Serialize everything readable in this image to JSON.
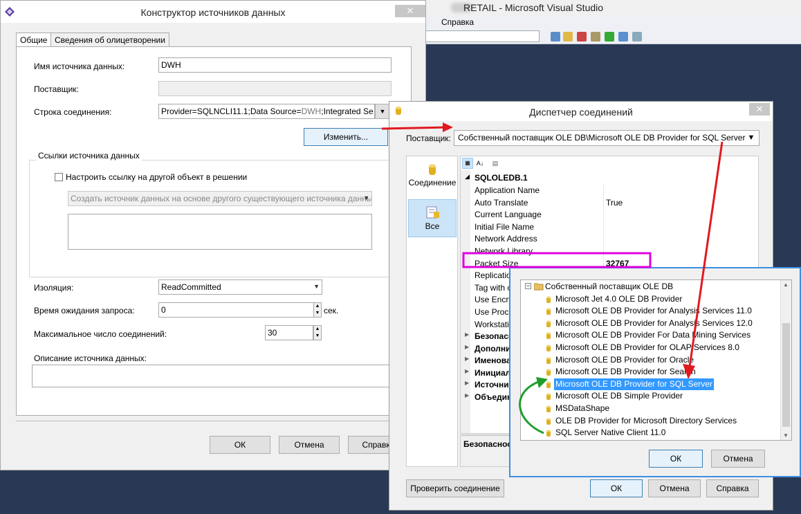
{
  "vs": {
    "title": "RETAIL - Microsoft Visual Studio",
    "menu_help": "Справка"
  },
  "dlg1": {
    "title": "Конструктор источников данных",
    "tabs": [
      "Общие",
      "Сведения об олицетворении"
    ],
    "ds_name_label": "Имя источника данных:",
    "ds_name_value": "DWH",
    "provider_label": "Поставщик:",
    "conn_label": "Строка соединения:",
    "conn_value": "Provider=SQLNCLI11.1;Data Source=",
    "conn_value_tail": "DWH",
    "conn_value_end": ";Integrated Se",
    "edit_button": "Изменить...",
    "refs_group": "Ссылки источника данных",
    "refs_checkbox": "Настроить ссылку на другой объект в решении",
    "refs_combo": "Создать источник данных на основе другого существующего источника данных",
    "isolation_label": "Изоляция:",
    "isolation_value": "ReadCommitted",
    "timeout_label": "Время ожидания запроса:",
    "timeout_value": "0",
    "timeout_unit": "сек.",
    "maxconn_label": "Максимальное число соединений:",
    "maxconn_value": "30",
    "desc_label": "Описание источника данных:",
    "ok": "ОК",
    "cancel": "Отмена",
    "help": "Справка"
  },
  "dlg2": {
    "title": "Диспетчер соединений",
    "provider_label": "Поставщик:",
    "provider_value": "Собственный поставщик OLE DB\\Microsoft OLE DB Provider for SQL Server",
    "side_items": [
      "Соединение",
      "Все"
    ],
    "grid_header": "SQLOLEDB.1",
    "rows": [
      {
        "k": "Application Name",
        "v": ""
      },
      {
        "k": "Auto Translate",
        "v": "True"
      },
      {
        "k": "Current Language",
        "v": ""
      },
      {
        "k": "Initial File Name",
        "v": ""
      },
      {
        "k": "Network Address",
        "v": ""
      },
      {
        "k": "Network Library",
        "v": ""
      },
      {
        "k": "Packet Size",
        "v": "32767"
      },
      {
        "k": "Replication",
        "v": ""
      },
      {
        "k": "Tag with c",
        "v": ""
      },
      {
        "k": "Use Encryp",
        "v": ""
      },
      {
        "k": "Use Proced",
        "v": ""
      },
      {
        "k": "Workstatio",
        "v": ""
      }
    ],
    "categories": [
      "Безопасн",
      "Дополни",
      "Именова",
      "Инициал",
      "Источник",
      "Объедин"
    ],
    "desc_title": "Безопасност",
    "test_button": "Проверить соединение",
    "ok": "ОК",
    "cancel": "Отмена",
    "help": "Справка"
  },
  "dlg3": {
    "root": "Собственный поставщик OLE DB",
    "items": [
      "Microsoft Jet 4.0 OLE DB Provider",
      "Microsoft OLE DB Provider for Analysis Services 11.0",
      "Microsoft OLE DB Provider for Analysis Services 12.0",
      "Microsoft OLE DB Provider For Data Mining Services",
      "Microsoft OLE DB Provider for OLAP Services 8.0",
      "Microsoft OLE DB Provider for Oracle",
      "Microsoft OLE DB Provider for Search",
      "Microsoft OLE DB Provider for SQL Server",
      "Microsoft OLE DB Simple Provider",
      "MSDataShape",
      "OLE DB Provider for Microsoft Directory Services",
      "SQL Server Native Client 11.0"
    ],
    "selected_index": 7,
    "ok": "ОК",
    "cancel": "Отмена"
  },
  "colors": {
    "selection": "#3399ff",
    "annotation_red": "#e0191f",
    "annotation_green": "#1f9e2e",
    "annotation_magenta": "#e000e0",
    "window_border_blue": "#3c8fe0"
  }
}
